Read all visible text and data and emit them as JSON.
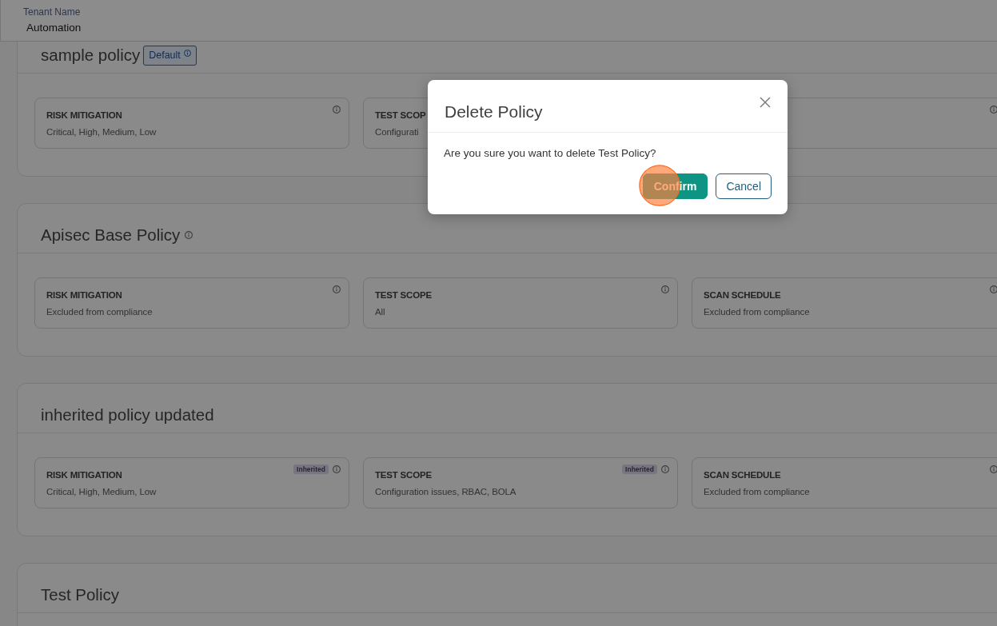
{
  "header": {
    "label": "Tenant Name",
    "value": "Automation"
  },
  "policies": [
    {
      "name": "sample policy",
      "badge": {
        "label": "Default",
        "info": true
      },
      "info": false,
      "tiles": [
        {
          "label": "RISK MITIGATION",
          "value": "Critical, High, Medium, Low",
          "info": true
        },
        {
          "label": "TEST SCOP",
          "value": "Configurati",
          "info": false
        },
        {
          "info": true
        }
      ]
    },
    {
      "name": "Apisec Base Policy",
      "info": true,
      "tiles": [
        {
          "label": "RISK MITIGATION",
          "value": "Excluded from compliance",
          "info": true
        },
        {
          "label": "TEST SCOPE",
          "value": "All",
          "info": true
        },
        {
          "label": "SCAN SCHEDULE",
          "value": "Excluded from compliance",
          "info": true
        }
      ]
    },
    {
      "name": "inherited policy updated",
      "info": false,
      "tiles": [
        {
          "label": "RISK MITIGATION",
          "value": "Critical, High, Medium, Low",
          "tag": "Inherited",
          "info": true
        },
        {
          "label": "TEST SCOPE",
          "value": "Configuration issues, RBAC, BOLA",
          "tag": "Inherited",
          "info": true
        },
        {
          "label": "SCAN SCHEDULE",
          "value": "Excluded from compliance",
          "info": true
        }
      ]
    },
    {
      "name": "Test Policy",
      "info": false
    }
  ],
  "dialog": {
    "title": "Delete Policy",
    "message": "Are you sure you want to delete Test Policy?",
    "buttons": [
      {
        "label": "Confirm",
        "kind": "primary",
        "click_marker": true
      },
      {
        "label": "Cancel",
        "kind": "secondary",
        "click_marker": false
      }
    ]
  }
}
